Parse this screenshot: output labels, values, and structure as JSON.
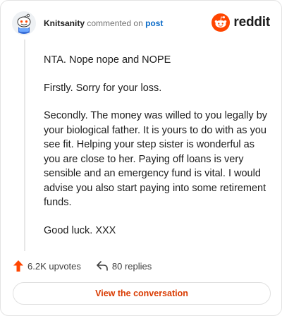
{
  "comment": {
    "author": "Knitsanity",
    "action_text": "commented on",
    "target_link": "post",
    "brand": "reddit",
    "paragraphs": [
      "NTA. Nope nope and NOPE",
      "Firstly. Sorry for your loss.",
      "Secondly. The money was willed to you legally by your biological father. It is yours to do with as you see fit. Helping your step sister is wonderful as you are close to her. Paying off loans is very sensible and an emergency fund is vital. I would advise you also start paying into some retirement funds.",
      "Good luck. XXX"
    ],
    "upvotes": "6.2K upvotes",
    "replies": "80 replies",
    "cta": "View the conversation"
  },
  "colors": {
    "brand_orange": "#ff4500",
    "link_blue": "#0a6ac7",
    "cta_text": "#d93a00"
  },
  "icons": [
    "avatar-snoo",
    "reddit-logo-icon",
    "upvote-arrow-icon",
    "reply-arrow-icon"
  ]
}
